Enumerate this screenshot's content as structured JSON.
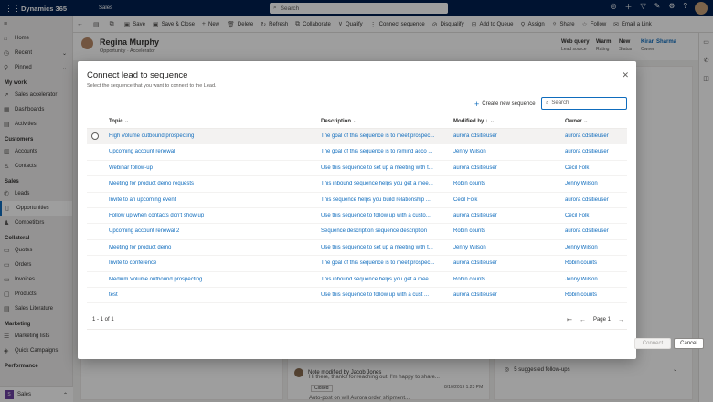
{
  "topbar": {
    "app": "Dynamics 365",
    "area": "Sales",
    "search_label": "Search",
    "icons": [
      "lightbulb-icon",
      "plus-icon",
      "filter-icon",
      "assistant-icon",
      "settings-icon",
      "help-icon"
    ]
  },
  "command_bar": [
    {
      "label": "",
      "icon": "back-icon"
    },
    {
      "label": "",
      "icon": "form-icon"
    },
    {
      "label": "",
      "icon": "popout-icon"
    },
    {
      "label": "Save",
      "icon": "save-icon"
    },
    {
      "label": "Save & Close",
      "icon": "save-close-icon"
    },
    {
      "label": "New",
      "icon": "plus-icon"
    },
    {
      "label": "Delete",
      "icon": "delete-icon"
    },
    {
      "label": "Refresh",
      "icon": "refresh-icon"
    },
    {
      "label": "Collaborate",
      "icon": "collaborate-icon"
    },
    {
      "label": "Qualify",
      "icon": "qualify-icon"
    },
    {
      "label": "Connect sequence",
      "icon": "sequence-icon"
    },
    {
      "label": "Disqualify",
      "icon": "disqualify-icon"
    },
    {
      "label": "Add to Queue",
      "icon": "queue-icon"
    },
    {
      "label": "Assign",
      "icon": "assign-icon"
    },
    {
      "label": "Share",
      "icon": "share-icon"
    },
    {
      "label": "Follow",
      "icon": "star-icon"
    },
    {
      "label": "Email a Link",
      "icon": "email-icon"
    }
  ],
  "nav": {
    "top": [
      {
        "label": "Home",
        "icon": "home-icon"
      },
      {
        "label": "Recent",
        "icon": "clock-icon"
      },
      {
        "label": "Pinned",
        "icon": "pin-icon"
      }
    ],
    "groups": [
      {
        "title": "My work",
        "items": [
          {
            "label": "Sales accelerator",
            "icon": "rocket-icon"
          },
          {
            "label": "Dashboards",
            "icon": "dashboard-icon"
          },
          {
            "label": "Activities",
            "icon": "activities-icon"
          }
        ]
      },
      {
        "title": "Customers",
        "items": [
          {
            "label": "Accounts",
            "icon": "building-icon"
          },
          {
            "label": "Contacts",
            "icon": "person-icon"
          }
        ]
      },
      {
        "title": "Sales",
        "items": [
          {
            "label": "Leads",
            "icon": "phone-icon"
          },
          {
            "label": "Opportunities",
            "icon": "opportunity-icon",
            "selected": true
          },
          {
            "label": "Competitors",
            "icon": "competitor-icon"
          }
        ]
      },
      {
        "title": "Collateral",
        "items": [
          {
            "label": "Quotes",
            "icon": "quote-icon"
          },
          {
            "label": "Orders",
            "icon": "order-icon"
          },
          {
            "label": "Invoices",
            "icon": "invoice-icon"
          },
          {
            "label": "Products",
            "icon": "product-icon"
          },
          {
            "label": "Sales Literature",
            "icon": "literature-icon"
          }
        ]
      },
      {
        "title": "Marketing",
        "items": [
          {
            "label": "Marketing lists",
            "icon": "list-icon"
          },
          {
            "label": "Quick Campaigns",
            "icon": "campaign-icon"
          }
        ]
      },
      {
        "title": "Performance",
        "items": []
      }
    ],
    "area_switcher": {
      "badge": "S",
      "label": "Sales"
    }
  },
  "record": {
    "name": "Regina Murphy",
    "subtitle": "Opportunity · Accelerator",
    "fields": [
      {
        "value": "Web query",
        "label": "Lead source"
      },
      {
        "value": "Warm",
        "label": "Rating"
      },
      {
        "value": "New",
        "label": "Status"
      },
      {
        "value": "Kiran Sharma",
        "label": "Owner"
      }
    ]
  },
  "background": {
    "note_text": "Note modified by Jacob Jones",
    "note_body": "Hi there, thanks for reaching out. I'm happy to share...",
    "note_tag": "Closed",
    "note_time": "8/10/2019 1:23 PM",
    "autopost": "Auto-post on will Aurora order shipment...",
    "followups": "5 suggested follow-ups"
  },
  "dialog": {
    "title": "Connect lead to sequence",
    "subtitle": "Select the sequence that you want to connect to the Lead.",
    "new_sequence_label": "Create new sequence",
    "search_placeholder": "Search",
    "columns": {
      "topic": "Topic",
      "description": "Description",
      "modified_by": "Modified by",
      "owner": "Owner"
    },
    "rows": [
      {
        "topic": "High Volume outbound prospecting",
        "description": "The goal of this sequence is to meet prospec...",
        "modified_by": "aurora cdsitieuser",
        "owner": "aurora cdsitieuser"
      },
      {
        "topic": "Upcoming account renewal",
        "description": "The goal of this sequence is to remind acco ...",
        "modified_by": "Jenny Wilson",
        "owner": "aurora cdsitieuser"
      },
      {
        "topic": "Webinar follow-up",
        "description": "Use this sequence to set up a meeting with t...",
        "modified_by": "aurora cdsitieuser",
        "owner": "Cecil Folk"
      },
      {
        "topic": "Meeting for product demo requests",
        "description": "This inbound sequence helps you get a mee...",
        "modified_by": "Robin counts",
        "owner": "Jenny Wilson"
      },
      {
        "topic": "Invite to an upcoming event",
        "description": "This sequence helps you build relationship ...",
        "modified_by": "Cecil Folk",
        "owner": "aurora cdsitieuser"
      },
      {
        "topic": "Follow up when contacts don't show up",
        "description": "Use this sequence to follow up with a custo...",
        "modified_by": "aurora cdsitieuser",
        "owner": "Cecil Folk"
      },
      {
        "topic": "Upcoming account renewal 2",
        "description": "Sequence description sequence description",
        "modified_by": "Robin counts",
        "owner": "aurora cdsitieuser"
      },
      {
        "topic": "Meeting for product demo",
        "description": "Use this sequence to set up a meeting with t...",
        "modified_by": "Jenny Wilson",
        "owner": "Jenny Wilson"
      },
      {
        "topic": "Invite to conference",
        "description": "The goal of this sequence is to meet prospec...",
        "modified_by": "aurora cdsitieuser",
        "owner": "Robin counts"
      },
      {
        "topic": "Medium Volume outbound prospecting",
        "description": "This inbound sequence helps you get a mee...",
        "modified_by": "Robin counts",
        "owner": "Jenny Wilson"
      },
      {
        "topic": "test",
        "description": "Use this sequence to follow up with a cust ...",
        "modified_by": "aurora cdsitieuser",
        "owner": "Robin counts"
      }
    ],
    "count_text": "1 - 1 of 1",
    "page_text": "Page 1",
    "connect_label": "Connect",
    "cancel_label": "Cancel"
  },
  "colors": {
    "accent": "#0f6cbd",
    "topbar": "#002050"
  }
}
